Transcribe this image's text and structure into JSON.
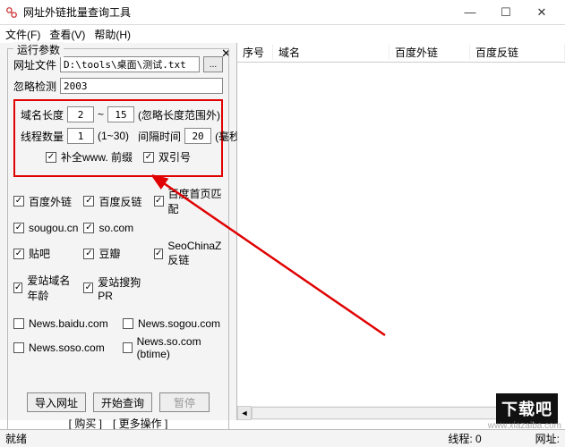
{
  "window": {
    "title": "网址外链批量查询工具",
    "min": "—",
    "max": "☐",
    "close": "✕"
  },
  "menu": {
    "file": "文件(F)",
    "view": "查看(V)",
    "help": "帮助(H)"
  },
  "panel": {
    "pinoff": "✕",
    "title": "运行参数",
    "urlfile_label": "网址文件",
    "urlfile_value": "D:\\tools\\桌面\\测试.txt",
    "browse": "...",
    "ignore_label": "忽略检测",
    "ignore_value": "2003",
    "domain_len_label": "域名长度",
    "domain_len_min": "2",
    "tilde": "~",
    "domain_len_max": "15",
    "domain_len_note": "(忽略长度范围外)",
    "thread_label": "线程数量",
    "thread_value": "1",
    "thread_note": "(1~30)",
    "interval_label": "间隔时间",
    "interval_value": "20",
    "interval_unit": "(毫秒)",
    "prefix_cb": "补全www. 前缀",
    "quote_cb": "双引号",
    "cb_baidu_out": "百度外链",
    "cb_baidu_back": "百度反链",
    "cb_baidu_home": "百度首页匹配",
    "cb_sougou": "sougou.cn",
    "cb_so": "so.com",
    "cb_tieba": "贴吧",
    "cb_douban": "豆瓣",
    "cb_seochina": "SeoChinaZ反链",
    "cb_aizhan_age": "爱站域名年龄",
    "cb_aizhan_pr": "爱站搜狗PR",
    "cb_news_baidu": "News.baidu.com",
    "cb_news_sogou": "News.sogou.com",
    "cb_news_soso": "News.soso.com",
    "cb_news_so": "News.so.com (btime)",
    "btn_import": "导入网址",
    "btn_start": "开始查询",
    "btn_stop": "暂停",
    "link_buy": "[ 购买 ]",
    "link_more": "[ 更多操作 ]"
  },
  "table": {
    "col_seq": "序号",
    "col_domain": "域名",
    "col_out": "百度外链",
    "col_back": "百度反链"
  },
  "status": {
    "ready": "就绪",
    "threads": "线程: 0",
    "urlcount": "网址:"
  },
  "brand": {
    "logo": "下载吧",
    "url": "www.xiazaiba.com"
  }
}
